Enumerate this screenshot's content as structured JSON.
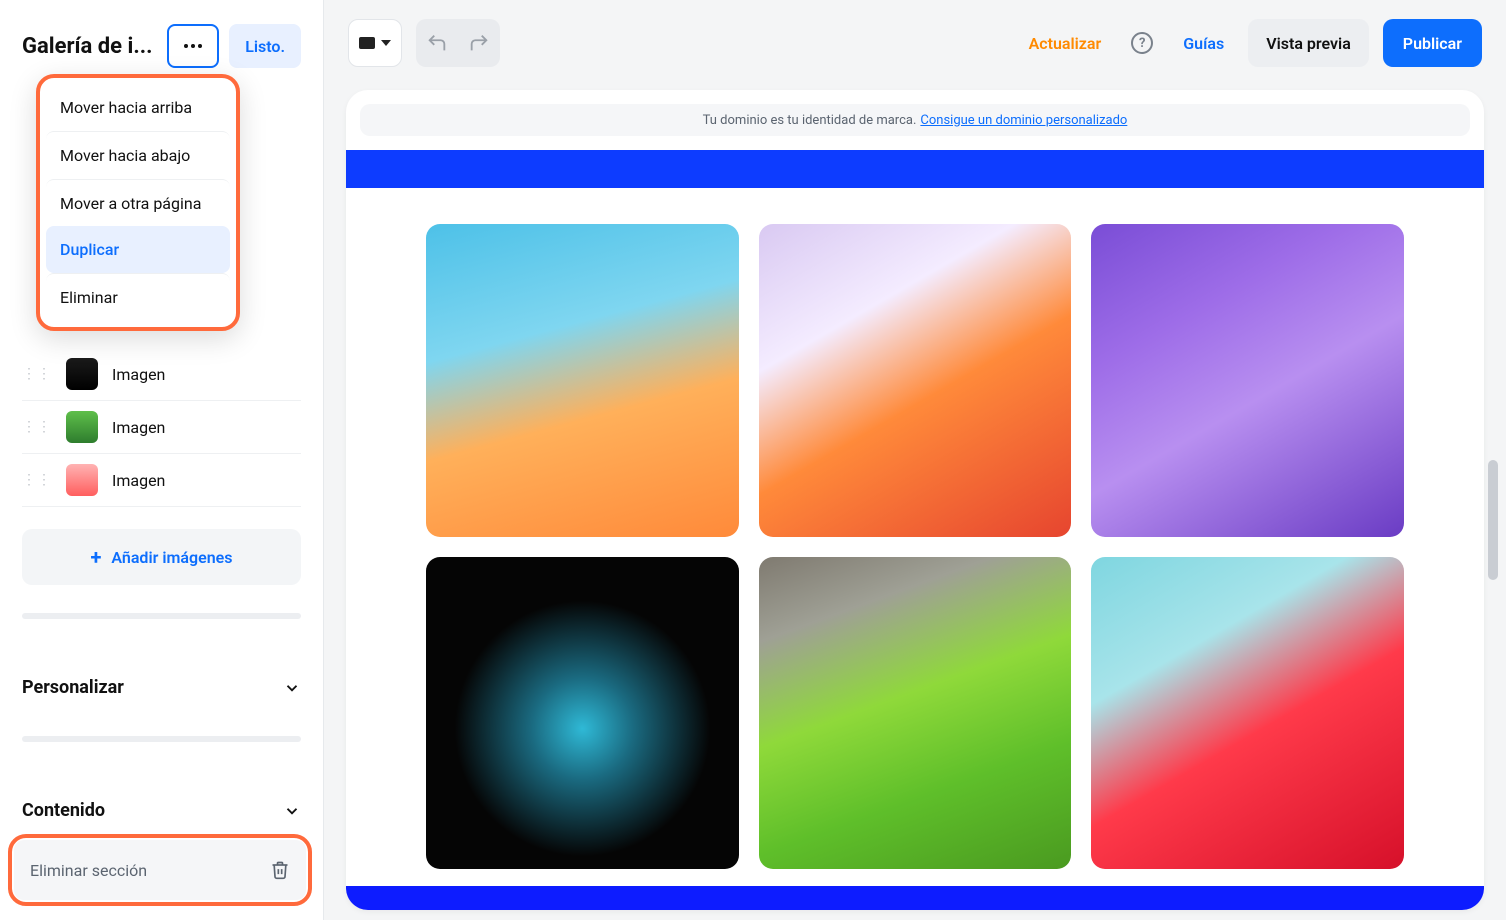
{
  "sidebar": {
    "title": "Galería de i...",
    "done_label": "Listo.",
    "dropdown": {
      "move_up": "Mover hacia arriba",
      "move_down": "Mover hacia abajo",
      "move_page": "Mover a otra página",
      "duplicate": "Duplicar",
      "delete": "Eliminar"
    },
    "images": [
      {
        "label": "Imagen"
      },
      {
        "label": "Imagen"
      },
      {
        "label": "Imagen"
      }
    ],
    "add_images": "Añadir imágenes",
    "personalize": "Personalizar",
    "content": "Contenido",
    "delete_section": "Eliminar sección"
  },
  "topbar": {
    "actualizar": "Actualizar",
    "guias": "Guías",
    "vista_previa": "Vista previa",
    "publicar": "Publicar"
  },
  "banner": {
    "text": "Tu dominio es tu identidad de marca.",
    "link": "Consigue un dominio personalizado"
  }
}
